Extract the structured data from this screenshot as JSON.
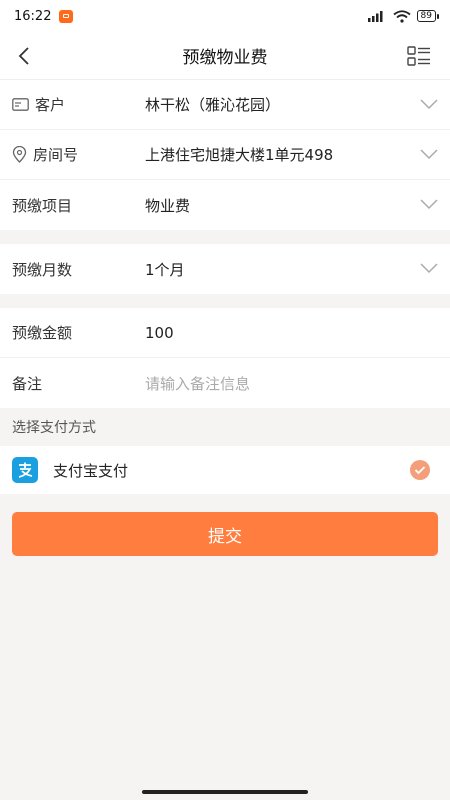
{
  "status_bar": {
    "time": "16:22",
    "battery": "89"
  },
  "header": {
    "title": "预缴物业费"
  },
  "form": {
    "customer": {
      "label": "客户",
      "value": "林干松（雅沁花园）"
    },
    "room": {
      "label": "房间号",
      "value": "上港住宅旭捷大楼1单元498"
    },
    "item": {
      "label": "预缴项目",
      "value": "物业费"
    },
    "months": {
      "label": "预缴月数",
      "value": "1个月"
    },
    "amount": {
      "label": "预缴金额",
      "value": "100"
    },
    "remark": {
      "label": "备注",
      "placeholder": "请输入备注信息"
    }
  },
  "payment": {
    "section_label": "选择支付方式",
    "method_label": "支付宝支付",
    "selected": true
  },
  "submit": {
    "label": "提交"
  },
  "colors": {
    "accent": "#ff7d3f",
    "alipay": "#1a9fe0",
    "check": "#f3a07a"
  }
}
